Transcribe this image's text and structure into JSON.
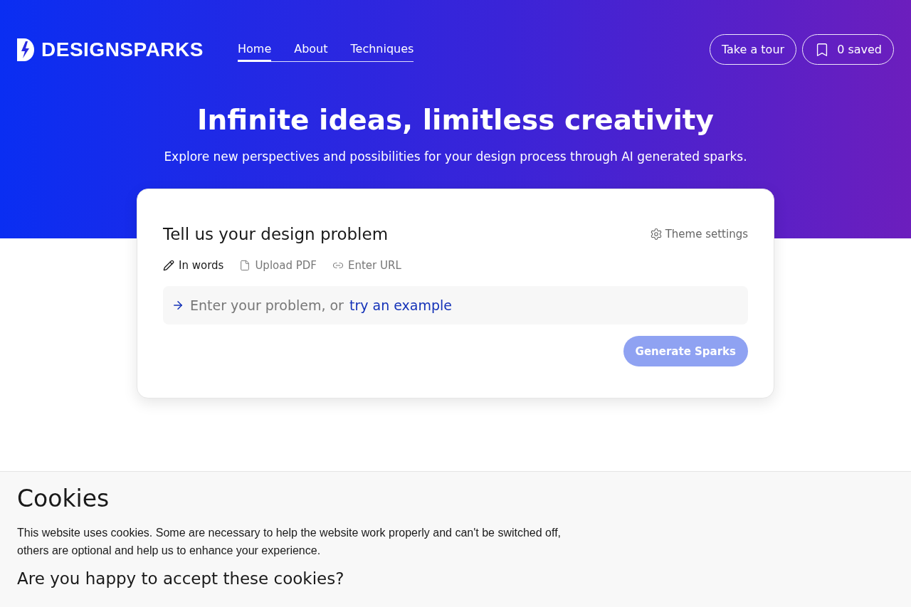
{
  "header": {
    "logo": "DESIGNSPARKS",
    "nav": [
      {
        "label": "Home",
        "selected": true
      },
      {
        "label": "About",
        "selected": false
      },
      {
        "label": "Techniques",
        "selected": false
      }
    ],
    "tour_button": "Take a tour",
    "saved_button": "0 saved"
  },
  "hero": {
    "title": "Infinite ideas, limitless creativity",
    "subtitle": "Explore new perspectives and possibilities for your design process through AI generated sparks."
  },
  "card": {
    "title": "Tell us your design problem",
    "theme_settings": "Theme settings",
    "modes": [
      {
        "label": "In words",
        "selected": true
      },
      {
        "label": "Upload PDF",
        "selected": false
      },
      {
        "label": "Enter URL",
        "selected": false
      }
    ],
    "input": {
      "placeholder": "Enter your problem, or",
      "example_link": "try an example"
    },
    "generate_button": {
      "label": "Generate Sparks",
      "disabled": true
    }
  },
  "cookies": {
    "title": "Cookies",
    "text": "This website uses cookies. Some are necessary to help the website work properly and can't be switched off, others are optional and help us to enhance your experience.",
    "question": "Are you happy to accept these cookies?"
  }
}
